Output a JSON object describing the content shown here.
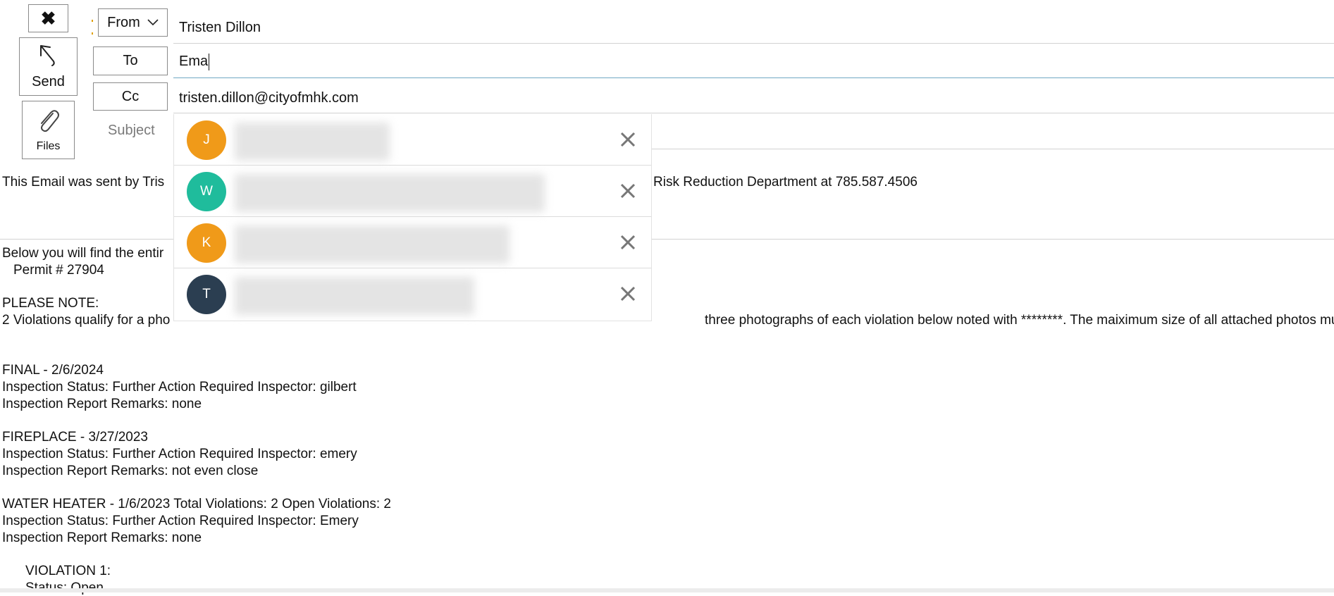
{
  "toolbar": {
    "close_icon": "close-x-icon",
    "send_label": "Send",
    "send_icon": "send-arrow-icon",
    "files_label": "Files",
    "files_icon": "paperclip-icon"
  },
  "header": {
    "from_label": "From",
    "from_value": "Tristen Dillon",
    "to_label": "To",
    "to_value": "Ema",
    "cc_label": "Cc",
    "cc_value": "tristen.dillon@cityofmhk.com",
    "subject_label": "Subject",
    "subject_value": ""
  },
  "suggestions": [
    {
      "initial": "J",
      "color": "#f09a19"
    },
    {
      "initial": "W",
      "color": "#1fbc9c"
    },
    {
      "initial": "K",
      "color": "#f09a19"
    },
    {
      "initial": "T",
      "color": "#2b3e51"
    }
  ],
  "body": {
    "intro_left": "This Email was sent by Tris",
    "intro_right": "Risk Reduction Department at 785.587.4506",
    "line_below": "Below you will find the entir",
    "permit": "Permit # 27904",
    "note_title": "PLEASE NOTE:",
    "note_left": "2 Violations qualify for a pho",
    "note_right": "three photographs of each violation below noted with ********. The maiximum size of all attached photos must not e",
    "final_title": "FINAL - 2/6/2024",
    "final_status": "Inspection Status: Further Action Required   Inspector: gilbert",
    "final_remarks": "Inspection Report Remarks: none",
    "fireplace_title": "FIREPLACE - 3/27/2023",
    "fireplace_status": "Inspection Status: Further Action Required   Inspector: emery",
    "fireplace_remarks": "Inspection Report Remarks: not even close",
    "water_title": "WATER HEATER - 1/6/2023  Total Violations: 2   Open Violations: 2",
    "water_status": "Inspection Status: Further Action Required   Inspector: Emery",
    "water_remarks": "Inspection Report Remarks: none",
    "violation1": "VIOLATION 1:",
    "violation1_status": "Status: Open"
  }
}
